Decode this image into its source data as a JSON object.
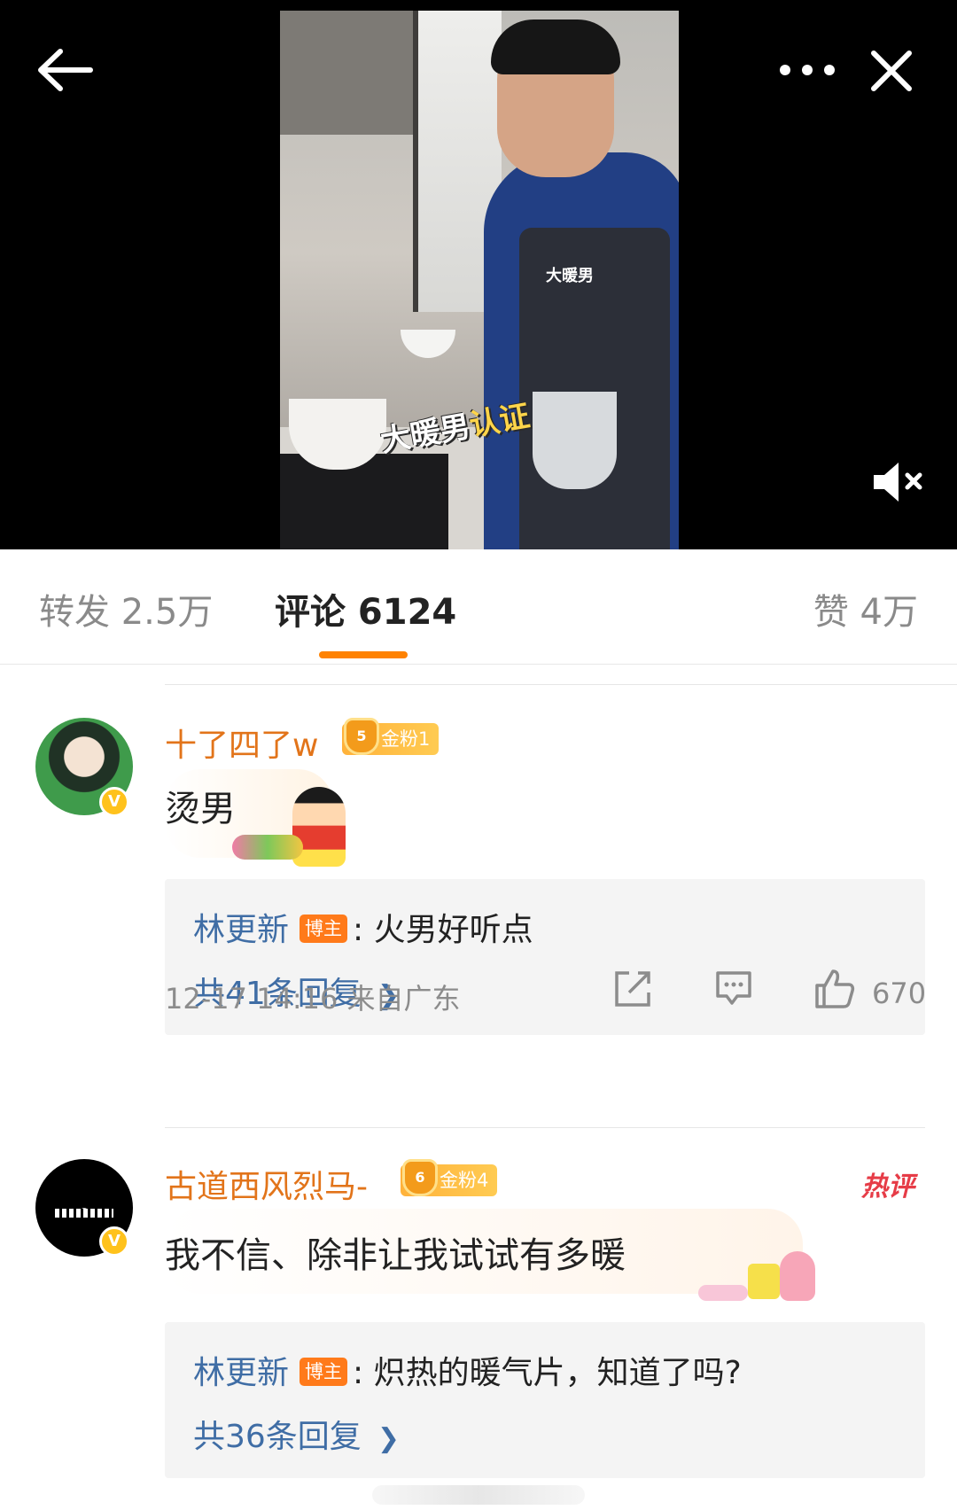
{
  "video": {
    "apron_text": "大暖男",
    "caption_main": "大暖男",
    "caption_highlight": "认证",
    "muted": true
  },
  "tabs": {
    "repost": "转发 2.5万",
    "comment": "评论 6124",
    "like": "赞 4万",
    "active": "comment"
  },
  "comments": [
    {
      "username": "十了四了w",
      "fan_level_crown": "5",
      "fan_badge": "金粉1",
      "verified_icon": "V",
      "text": "烫男",
      "reply": {
        "author": "林更新",
        "author_badge": "博主",
        "text": ": 火男好听点",
        "count": "共41条回复"
      },
      "timestamp": "12-17 14:16 来自广东",
      "likes": "670"
    },
    {
      "username": "古道西风烈马-",
      "fan_level_crown": "6",
      "fan_badge": "金粉4",
      "verified_icon": "V",
      "hot_badge": "热评",
      "text": "我不信、除非让我试试有多暖",
      "reply": {
        "author": "林更新",
        "author_badge": "博主",
        "text": ": 炽热的暖气片，知道了吗?",
        "count": "共36条回复"
      }
    }
  ],
  "colors": {
    "accent": "#ff8200",
    "username": "#e2741a",
    "link": "#3f6da5",
    "hot": "#e63c47"
  },
  "icons": [
    "back-arrow-icon",
    "more-dots-icon",
    "close-icon",
    "mute-icon",
    "chevron-right-icon",
    "share-icon",
    "comment-reply-icon",
    "thumbs-up-icon",
    "verified-v-icon",
    "crown-icon"
  ]
}
